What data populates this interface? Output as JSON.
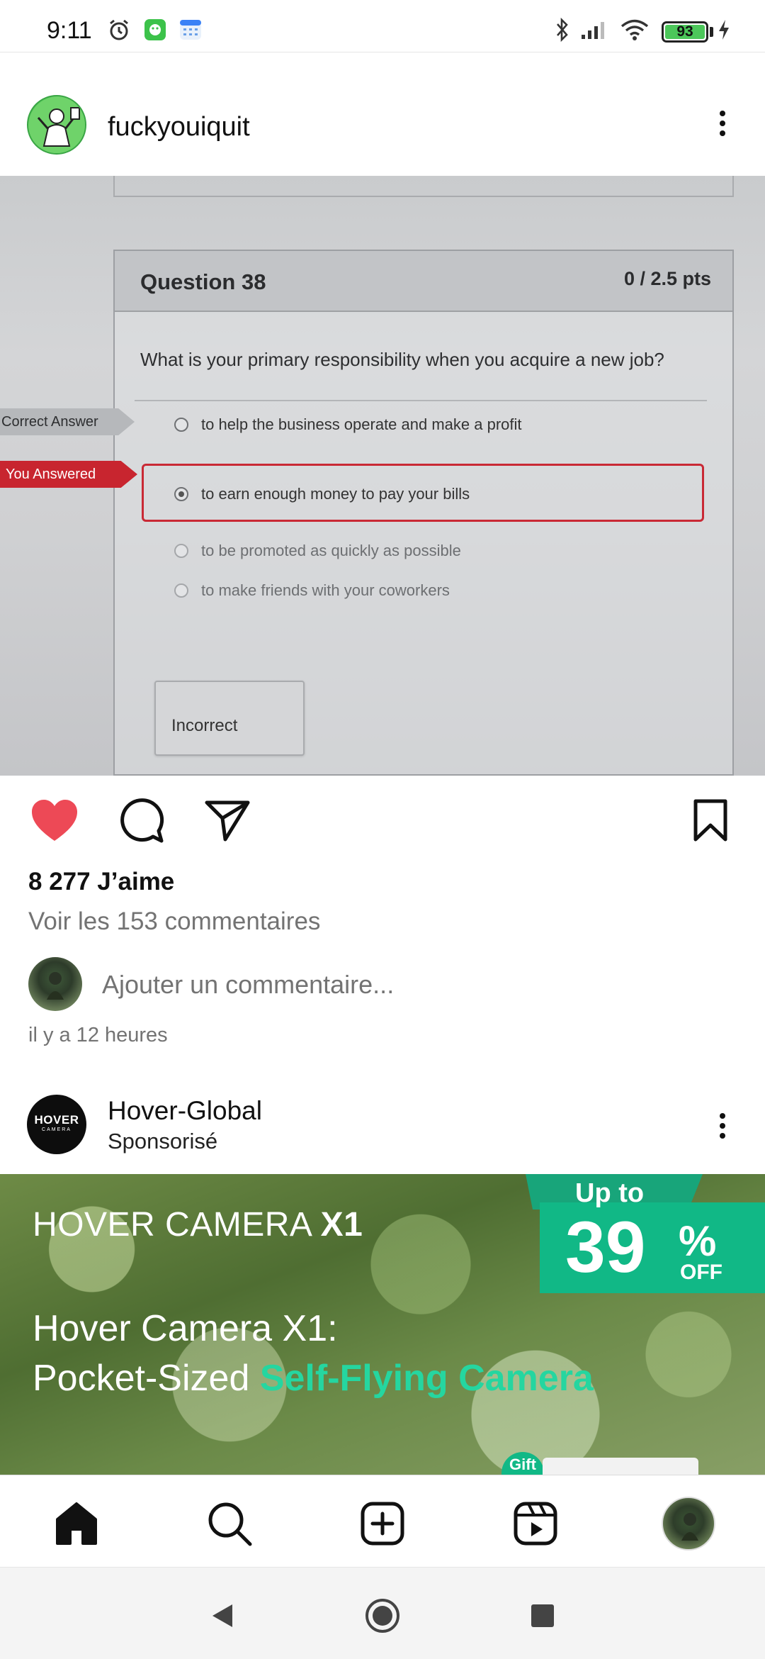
{
  "status_bar": {
    "time": "9:11",
    "battery": "93",
    "battery_fraction": 0.93,
    "icons": [
      "alarm-icon",
      "app-notification-icon",
      "calendar-icon",
      "bluetooth-icon",
      "signal-icon",
      "wifi-icon",
      "charging-icon"
    ]
  },
  "post": {
    "username": "fuckyouiquit",
    "image": {
      "question_title": "Question 38",
      "points": "0 / 2.5 pts",
      "question_text": "What is your primary responsibility when you acquire a new job?",
      "tag_correct": "Correct Answer",
      "tag_you_answered": "You Answered",
      "options": [
        "to help the business operate and make a profit",
        "to earn enough money to pay your bills",
        "to be promoted as quickly as possible",
        "to make friends with your coworkers"
      ],
      "result": "Incorrect"
    },
    "liked": true,
    "likes": "8 277 J’aime",
    "view_comments": "Voir les 153 commentaires",
    "add_comment_placeholder": "Ajouter un commentaire...",
    "timestamp": "il y a 12 heures"
  },
  "sponsored": {
    "name": "Hover-Global",
    "label": "Sponsorisé",
    "logo_line1": "HOVER",
    "logo_line2": "CAMERA",
    "ad": {
      "brand": "HOVER CAMERA",
      "brand_suffix": "X1",
      "headline_line1": "Hover Camera X1:",
      "headline_line2_plain": "Pocket-Sized",
      "headline_line2_accent": "Self-Flying Camera",
      "promo_upto": "Up to",
      "promo_number": "39",
      "promo_percent": "%",
      "promo_off": "OFF",
      "gift_chip": "Gift"
    }
  },
  "bottom_nav": [
    "home-icon",
    "search-icon",
    "create-icon",
    "reels-icon",
    "profile-avatar"
  ],
  "colors": {
    "like_red": "#ed4956",
    "accent_green": "#11b886",
    "error_red": "#c92935",
    "muted_text": "#737373"
  }
}
